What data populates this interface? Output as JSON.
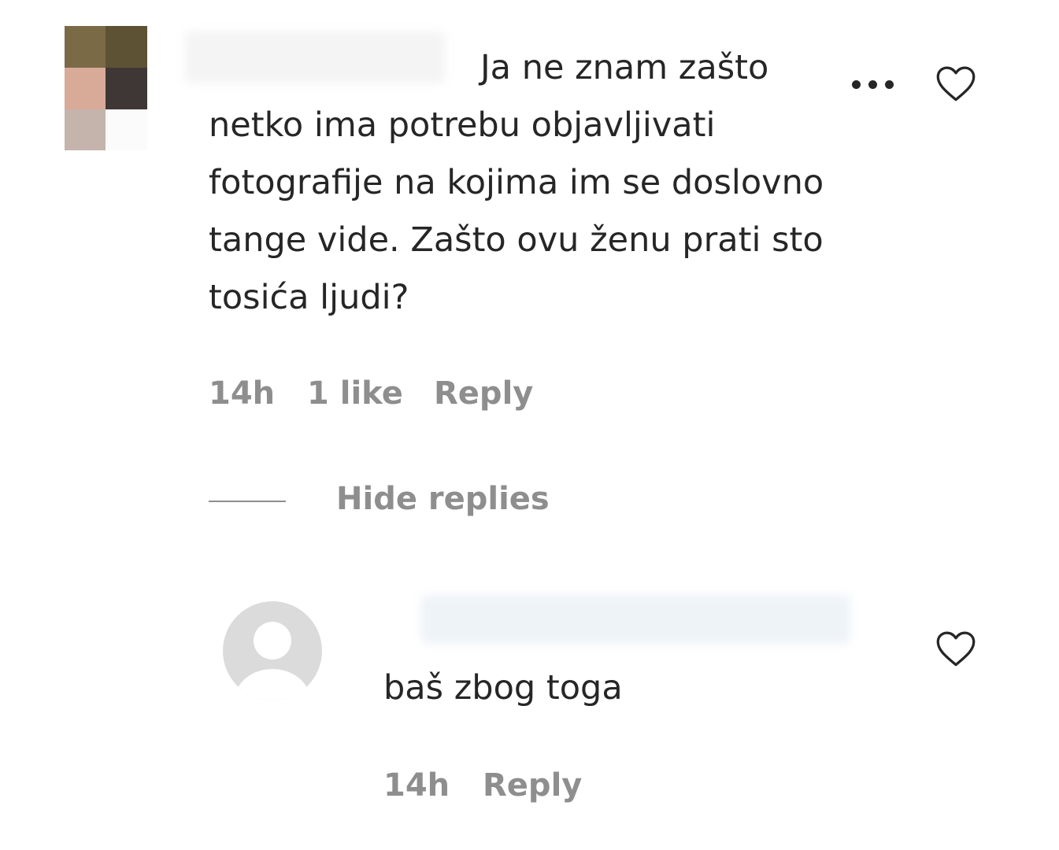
{
  "comment": {
    "text": "Ja ne znam zašto netko ima potrebu objavljivati fotografije na kojima im se doslovno tange vide. Zašto ovu ženu prati sto tosića ljudi?",
    "time": "14h",
    "likes": "1 like",
    "reply_label": "Reply",
    "more_icon": "more-horizontal-icon",
    "like_icon": "heart-outline-icon"
  },
  "thread": {
    "hide_replies_label": "Hide replies"
  },
  "reply": {
    "text": "baš zbog toga",
    "time": "14h",
    "reply_label": "Reply",
    "avatar_icon": "default-user-avatar-icon",
    "like_icon": "heart-outline-icon"
  },
  "colors": {
    "text_primary": "#262626",
    "text_secondary": "#8e8e8e",
    "avatar_placeholder": "#dbdbdb"
  }
}
